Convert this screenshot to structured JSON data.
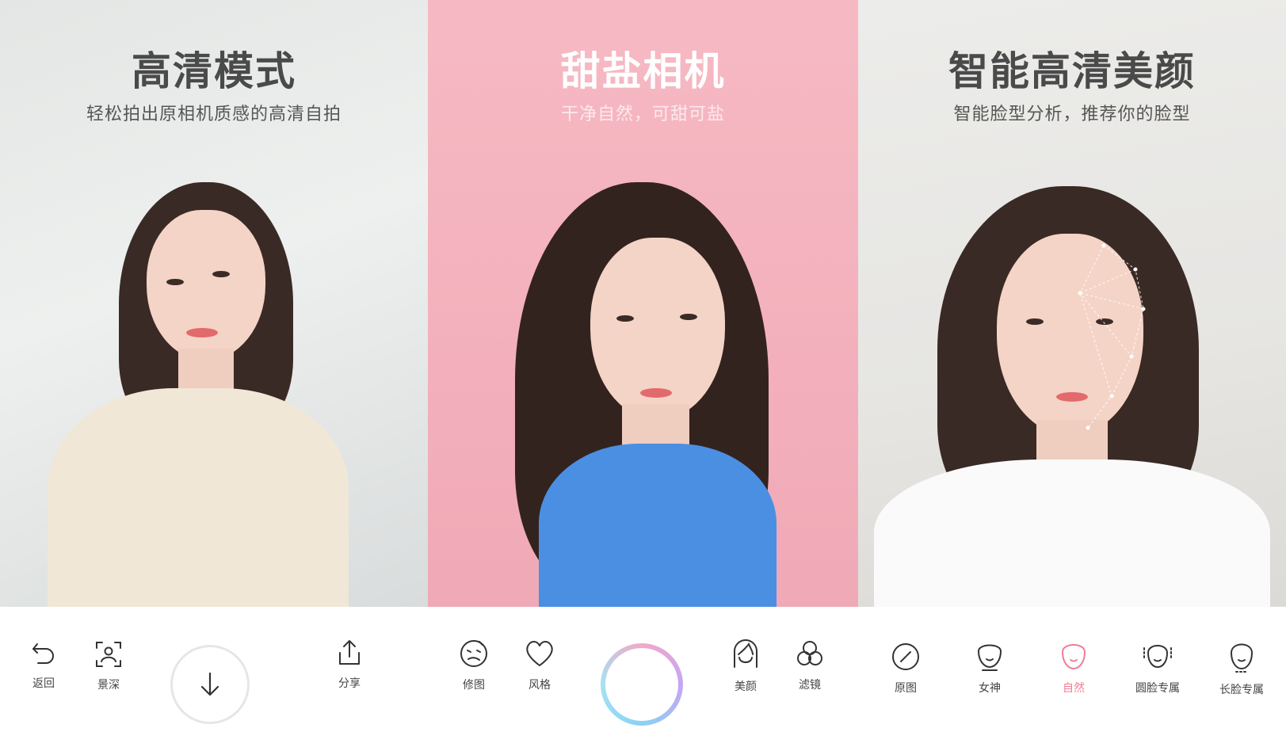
{
  "panels": [
    {
      "title": "高清模式",
      "subtitle": "轻松拍出原相机质感的高清自拍"
    },
    {
      "title": "甜盐相机",
      "subtitle": "干净自然，可甜可盐"
    },
    {
      "title": "智能高清美颜",
      "subtitle": "智能脸型分析，推荐你的脸型"
    }
  ],
  "toolbar": {
    "back": "返回",
    "depth": "景深",
    "share": "分享",
    "retouch": "修图",
    "style": "风格",
    "beauty": "美颜",
    "filter": "滤镜",
    "original": "原图",
    "goddess": "女神",
    "natural": "自然",
    "round_face": "圆脸专属",
    "long_face": "长脸专属"
  },
  "icons": {
    "back": "undo-arrow-icon",
    "depth": "portrait-focus-icon",
    "save": "download-arrow-icon",
    "share": "share-upload-icon",
    "retouch": "face-edit-icon",
    "style": "heart-icon",
    "beauty": "hair-face-icon",
    "filter": "three-circles-icon",
    "original": "slash-circle-icon",
    "goddess": "face-outline-icon",
    "natural": "face-outline-icon",
    "round_face": "round-face-icon",
    "long_face": "long-face-icon"
  },
  "colors": {
    "accent": "#f07d97",
    "panel_pink": "#f4b3be",
    "text_dark": "#4a4a4a"
  }
}
